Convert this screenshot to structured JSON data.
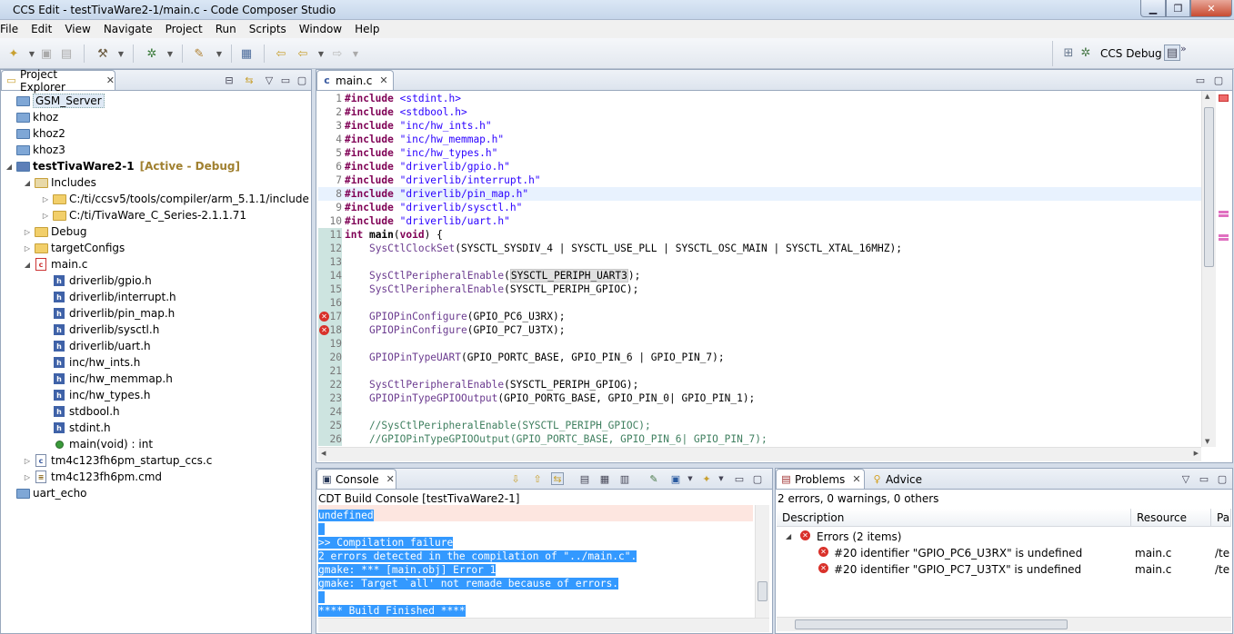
{
  "window": {
    "title": "CCS Edit - testTivaWare2-1/main.c - Code Composer Studio",
    "controls": {
      "minimize": "▁",
      "maximize": "❐",
      "close": "✕"
    }
  },
  "menu": [
    "File",
    "Edit",
    "View",
    "Navigate",
    "Project",
    "Run",
    "Scripts",
    "Window",
    "Help"
  ],
  "perspective": {
    "name": "CCS Debug",
    "more": "»"
  },
  "project_explorer": {
    "title": "Project Explorer",
    "items": [
      {
        "label": "GSM_Server",
        "depth": 0,
        "icon": "project-folder"
      },
      {
        "label": "khoz",
        "depth": 0,
        "icon": "project-folder"
      },
      {
        "label": "khoz2",
        "depth": 0,
        "icon": "project-folder"
      },
      {
        "label": "khoz3",
        "depth": 0,
        "icon": "project-folder"
      },
      {
        "label": "testTivaWare2-1",
        "suffix": "[Active - Debug]",
        "depth": 0,
        "icon": "ccs-project"
      },
      {
        "label": "Includes",
        "depth": 1,
        "icon": "includes"
      },
      {
        "label": "C:/ti/ccsv5/tools/compiler/arm_5.1.1/include",
        "depth": 2,
        "icon": "include-folder"
      },
      {
        "label": "C:/ti/TivaWare_C_Series-2.1.1.71",
        "depth": 2,
        "icon": "include-folder"
      },
      {
        "label": "Debug",
        "depth": 1,
        "icon": "folder"
      },
      {
        "label": "targetConfigs",
        "depth": 1,
        "icon": "folder"
      },
      {
        "label": "main.c",
        "depth": 1,
        "icon": "c-file-error"
      },
      {
        "label": "driverlib/gpio.h",
        "depth": 2,
        "icon": "header"
      },
      {
        "label": "driverlib/interrupt.h",
        "depth": 2,
        "icon": "header"
      },
      {
        "label": "driverlib/pin_map.h",
        "depth": 2,
        "icon": "header"
      },
      {
        "label": "driverlib/sysctl.h",
        "depth": 2,
        "icon": "header"
      },
      {
        "label": "driverlib/uart.h",
        "depth": 2,
        "icon": "header"
      },
      {
        "label": "inc/hw_ints.h",
        "depth": 2,
        "icon": "header"
      },
      {
        "label": "inc/hw_memmap.h",
        "depth": 2,
        "icon": "header"
      },
      {
        "label": "inc/hw_types.h",
        "depth": 2,
        "icon": "header"
      },
      {
        "label": "stdbool.h",
        "depth": 2,
        "icon": "header"
      },
      {
        "label": "stdint.h",
        "depth": 2,
        "icon": "header"
      },
      {
        "label": "main(void) : int",
        "depth": 2,
        "icon": "function"
      },
      {
        "label": "tm4c123fh6pm_startup_ccs.c",
        "depth": 1,
        "icon": "c-file"
      },
      {
        "label": "tm4c123fh6pm.cmd",
        "depth": 1,
        "icon": "cmd-file"
      },
      {
        "label": "uart_echo",
        "depth": 0,
        "icon": "project-folder"
      }
    ]
  },
  "editor": {
    "tab": "main.c",
    "lines": [
      {
        "n": "1",
        "tokens": [
          [
            "kw",
            "#include "
          ],
          [
            "str",
            "<stdint.h>"
          ]
        ]
      },
      {
        "n": "2",
        "tokens": [
          [
            "kw",
            "#include "
          ],
          [
            "str",
            "<stdbool.h>"
          ]
        ]
      },
      {
        "n": "3",
        "tokens": [
          [
            "kw",
            "#include "
          ],
          [
            "str",
            "\"inc/hw_ints.h\""
          ]
        ]
      },
      {
        "n": "4",
        "tokens": [
          [
            "kw",
            "#include "
          ],
          [
            "str",
            "\"inc/hw_memmap.h\""
          ]
        ]
      },
      {
        "n": "5",
        "tokens": [
          [
            "kw",
            "#include "
          ],
          [
            "str",
            "\"inc/hw_types.h\""
          ]
        ]
      },
      {
        "n": "6",
        "tokens": [
          [
            "kw",
            "#include "
          ],
          [
            "str",
            "\"driverlib/gpio.h\""
          ]
        ]
      },
      {
        "n": "7",
        "tokens": [
          [
            "kw",
            "#include "
          ],
          [
            "str",
            "\"driverlib/interrupt.h\""
          ]
        ]
      },
      {
        "n": "8",
        "tokens": [
          [
            "kw",
            "#include "
          ],
          [
            "str",
            "\"driverlib/pin_map.h\""
          ]
        ]
      },
      {
        "n": "9",
        "tokens": [
          [
            "kw",
            "#include "
          ],
          [
            "str",
            "\"driverlib/sysctl.h\""
          ]
        ]
      },
      {
        "n": "10",
        "tokens": [
          [
            "kw",
            "#include "
          ],
          [
            "str",
            "\"driverlib/uart.h\""
          ]
        ]
      },
      {
        "n": "11",
        "tokens": [
          [
            "kw",
            "int "
          ],
          [
            "bold",
            "main"
          ],
          [
            "",
            "("
          ],
          [
            "kw",
            "void"
          ],
          [
            "",
            ") {"
          ]
        ]
      },
      {
        "n": "12",
        "tokens": [
          [
            "",
            "    "
          ],
          [
            "fn",
            "SysCtlClockSet"
          ],
          [
            "",
            "(SYSCTL_SYSDIV_4 | SYSCTL_USE_PLL | SYSCTL_OSC_MAIN | SYSCTL_XTAL_16MHZ);"
          ]
        ]
      },
      {
        "n": "13",
        "tokens": []
      },
      {
        "n": "14",
        "tokens": [
          [
            "",
            "    "
          ],
          [
            "fn",
            "SysCtlPeripheralEnable"
          ],
          [
            "",
            "("
          ],
          [
            "hl",
            "SYSCTL_PERIPH_UART3"
          ],
          [
            "",
            ");"
          ]
        ]
      },
      {
        "n": "15",
        "tokens": [
          [
            "",
            "    "
          ],
          [
            "fn",
            "SysCtlPeripheralEnable"
          ],
          [
            "",
            "(SYSCTL_PERIPH_GPIOC);"
          ]
        ]
      },
      {
        "n": "16",
        "tokens": []
      },
      {
        "n": "17",
        "tokens": [
          [
            "",
            "    "
          ],
          [
            "fn",
            "GPIOPinConfigure"
          ],
          [
            "",
            "(GPIO_PC6_U3RX);"
          ]
        ]
      },
      {
        "n": "18",
        "tokens": [
          [
            "",
            "    "
          ],
          [
            "fn",
            "GPIOPinConfigure"
          ],
          [
            "",
            "(GPIO_PC7_U3TX);"
          ]
        ]
      },
      {
        "n": "19",
        "tokens": []
      },
      {
        "n": "20",
        "tokens": [
          [
            "",
            "    "
          ],
          [
            "fn",
            "GPIOPinTypeUART"
          ],
          [
            "",
            "(GPIO_PORTC_BASE, GPIO_PIN_6 | GPIO_PIN_7);"
          ]
        ]
      },
      {
        "n": "21",
        "tokens": []
      },
      {
        "n": "22",
        "tokens": [
          [
            "",
            "    "
          ],
          [
            "fn",
            "SysCtlPeripheralEnable"
          ],
          [
            "",
            "(SYSCTL_PERIPH_GPIOG);"
          ]
        ]
      },
      {
        "n": "23",
        "tokens": [
          [
            "",
            "    "
          ],
          [
            "fn",
            "GPIOPinTypeGPIOOutput"
          ],
          [
            "",
            "(GPIO_PORTG_BASE, GPIO_PIN_0| GPIO_PIN_1);"
          ]
        ]
      },
      {
        "n": "24",
        "tokens": []
      },
      {
        "n": "25",
        "tokens": [
          [
            "cm",
            "    //SysCtlPeripheralEnable(SYSCTL_PERIPH_GPIOC);"
          ]
        ]
      },
      {
        "n": "26",
        "tokens": [
          [
            "cm",
            "    //GPIOPinTypeGPIOOutput(GPIO_PORTC_BASE, GPIO_PIN_6| GPIO_PIN_7);"
          ]
        ]
      }
    ]
  },
  "console": {
    "tab": "Console",
    "title": "CDT Build Console [testTivaWare2-1]",
    "lines": [
      "undefined",
      " ",
      ">> Compilation failure",
      "2 errors detected in the compilation of \"../main.c\".",
      "gmake: *** [main.obj] Error 1",
      "gmake: Target `all' not remade because of errors.",
      " ",
      "**** Build Finished ****"
    ]
  },
  "problems": {
    "tab": "Problems",
    "advice_tab": "Advice",
    "summary": "2 errors, 0 warnings, 0 others",
    "columns": [
      "Description",
      "Resource",
      "Pa"
    ],
    "group": "Errors (2 items)",
    "rows": [
      {
        "description": "#20 identifier \"GPIO_PC6_U3RX\" is undefined",
        "resource": "main.c",
        "path": "/te"
      },
      {
        "description": "#20 identifier \"GPIO_PC7_U3TX\" is undefined",
        "resource": "main.c",
        "path": "/te"
      }
    ]
  },
  "icons": {
    "close_tab": "✕",
    "view_menu": "▽",
    "minimize_view": "▭",
    "maximize_view": "▢",
    "error_mark": "✕"
  }
}
